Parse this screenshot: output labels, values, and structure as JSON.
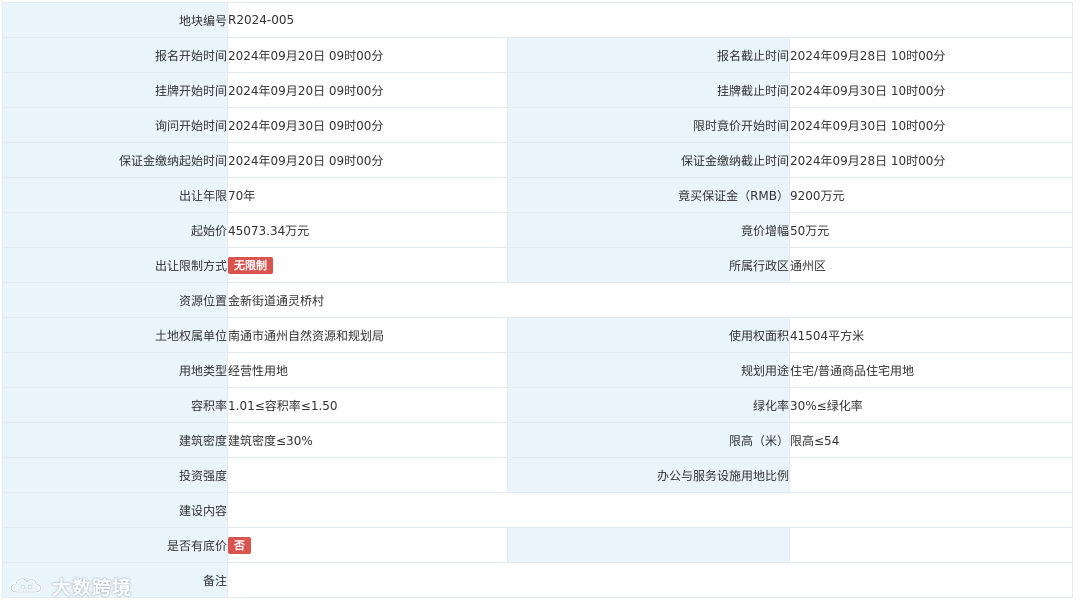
{
  "rows": [
    {
      "l1": "地块编号",
      "v1": "R2024-005"
    },
    {
      "l1": "报名开始时间",
      "v1": "2024年09月20日 09时00分",
      "l2": "报名截止时间",
      "v2": "2024年09月28日 10时00分"
    },
    {
      "l1": "挂牌开始时间",
      "v1": "2024年09月20日 09时00分",
      "l2": "挂牌截止时间",
      "v2": "2024年09月30日 10时00分"
    },
    {
      "l1": "询问开始时间",
      "v1": "2024年09月30日 09时00分",
      "l2": "限时竟价开始时间",
      "v2": "2024年09月30日 10时00分"
    },
    {
      "l1": "保证金缴纳起始时间",
      "v1": "2024年09月20日 09时00分",
      "l2": "保证金缴纳截止时间",
      "v2": "2024年09月28日 10时00分"
    },
    {
      "l1": "出让年限",
      "v1": "70年",
      "l2": "竟买保证金（RMB）",
      "v2": "9200万元"
    },
    {
      "l1": "起始价",
      "v1": "45073.34万元",
      "l2": "竟价增幅",
      "v2": "50万元"
    },
    {
      "l1": "出让限制方式",
      "v1_tag": "无限制",
      "l2": "所属行政区",
      "v2": "通州区"
    },
    {
      "l1": "资源位置",
      "v1": "金新街道通灵桥村"
    },
    {
      "l1": "土地权属单位",
      "v1": "南通市通州自然资源和规划局",
      "l2": "使用权面积",
      "v2": "41504平方米"
    },
    {
      "l1": "用地类型",
      "v1": "经营性用地",
      "l2": "规划用途",
      "v2": "住宅/普通商品住宅用地"
    },
    {
      "l1": "容积率",
      "v1": "1.01≤容积率≤1.50",
      "l2": "绿化率",
      "v2": "30%≤绿化率"
    },
    {
      "l1": "建筑密度",
      "v1": "建筑密度≤30%",
      "l2": "限高（米）",
      "v2": "限高≤54"
    },
    {
      "l1": "投资强度",
      "v1": "",
      "l2": "办公与服务设施用地比例",
      "v2": ""
    },
    {
      "l1": "建设内容",
      "v1": ""
    },
    {
      "l1": "是否有底价",
      "v1_tag": "否",
      "l2": "",
      "v2": ""
    },
    {
      "l1": "备注",
      "v1": ""
    }
  ],
  "watermark": {
    "text": "大数跨境",
    "icon": "cloud-logo-icon"
  },
  "colors": {
    "label_bg": "#eaf4fb",
    "border": "#e3eaf2",
    "tag_bg": "#d9534f"
  }
}
